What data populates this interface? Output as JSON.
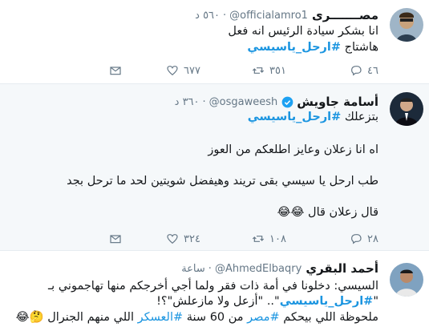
{
  "tweets": [
    {
      "name": "مصـــــــرى",
      "handle": "@officialamro1",
      "dot": "·",
      "time": "٥٦٠ د",
      "lines": [
        "انا بشكر سيادة الرئيس انه فعل"
      ],
      "hashtag_prefix": "هاشتاج",
      "hashtag": "#ارحل_ياسيسي",
      "replies": "٤٦",
      "retweets": "٣٥١",
      "likes": "٦٧٧"
    },
    {
      "name": "أسامة جاويش",
      "handle": "@osgaweesh",
      "dot": "·",
      "time": "٣٦٠ د",
      "hashtag_prefix": "بتزعلك",
      "hashtag": "#ارحل_ياسيسي",
      "lines": [
        "اه انا زعلان وعايز اطلعكم من العوز",
        "طب ارحل يا سيسي بقى تريند وهيفضل شويتين لحد ما ترحل بجد",
        "قال زعلان قال 😂😂"
      ],
      "replies": "٢٨",
      "retweets": "١٠٨",
      "likes": "٣٢٤"
    },
    {
      "name": "أحمد البقري",
      "handle": "@AhmedElbaqry",
      "dot": "·",
      "time": "ساعة",
      "lines": [
        "السيسي: دخلونا في أمة ذات فقر ولما أجي أخرجكم منها تهاجموني بـ",
        "\"أزعل ولا مازعلش\"؟!",
        "ملحوظة اللي بيحكم",
        "من 60 سنة",
        "اللي منهم الجنرال 🤔😂"
      ],
      "hashtag": "#ارحل_ياسيسي",
      "hashtag_suffix": "\"..",
      "hashtag_prefix": "\"",
      "tag_misr": "#مصر",
      "tag_askar": "#العسكر"
    }
  ]
}
